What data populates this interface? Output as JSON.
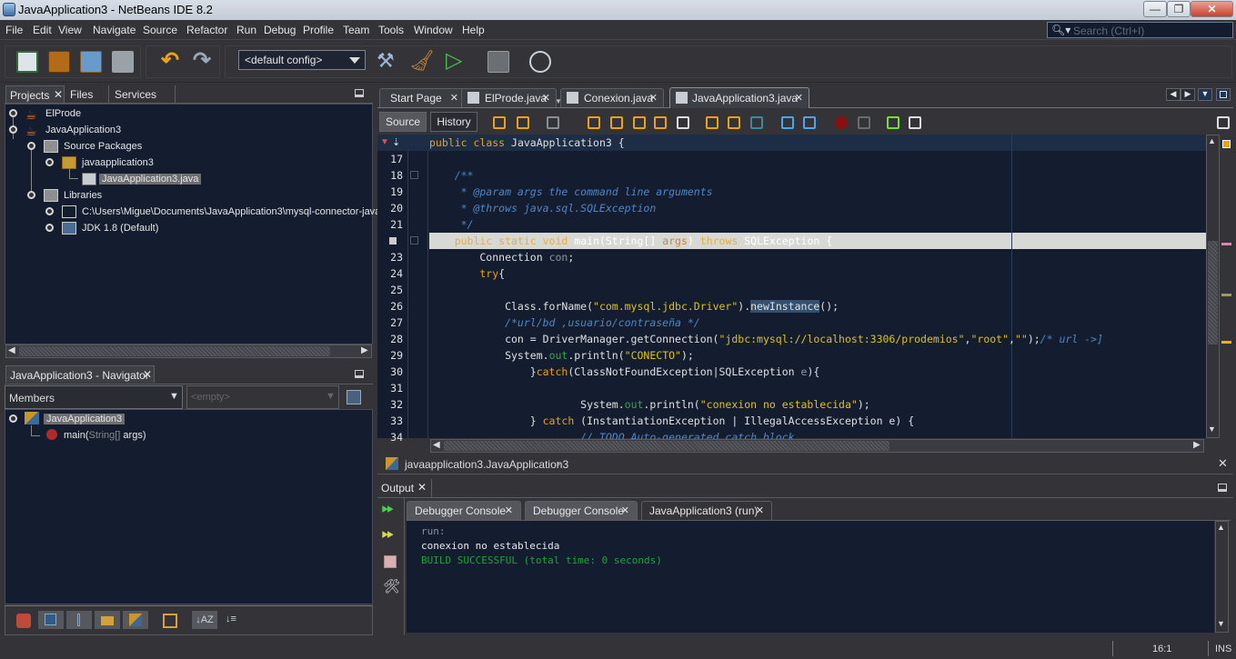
{
  "window": {
    "title": "JavaApplication3 - NetBeans IDE 8.2",
    "controls": [
      "minimize",
      "restore",
      "close"
    ]
  },
  "menu": [
    "File",
    "Edit",
    "View",
    "Navigate",
    "Source",
    "Refactor",
    "Run",
    "Debug",
    "Profile",
    "Team",
    "Tools",
    "Window",
    "Help"
  ],
  "search": {
    "placeholder": "Search (Ctrl+I)"
  },
  "toolbar": {
    "config_value": "<default config>",
    "icons": [
      "new-file-icon",
      "new-project-icon",
      "open-project-icon",
      "close-project-icon",
      "undo-icon",
      "redo-icon",
      "build-icon",
      "clean-build-icon",
      "run-icon",
      "debug-icon",
      "profile-icon"
    ]
  },
  "projects_panel": {
    "tabs": [
      {
        "label": "Projects",
        "closable": true
      },
      {
        "label": "Files"
      },
      {
        "label": "Services"
      }
    ],
    "tree": [
      {
        "label": "ElProde",
        "level": 0,
        "icon": "java-project-icon"
      },
      {
        "label": "JavaApplication3",
        "level": 0,
        "icon": "java-project-icon"
      },
      {
        "label": "Source Packages",
        "level": 1,
        "icon": "source-packages-icon"
      },
      {
        "label": "javaapplication3",
        "level": 2,
        "icon": "package-icon"
      },
      {
        "label": "JavaApplication3.java",
        "level": 3,
        "icon": "java-main-file-icon",
        "selected": true
      },
      {
        "label": "Libraries",
        "level": 1,
        "icon": "libraries-icon"
      },
      {
        "label": "C:\\Users\\Migue\\Documents\\JavaApplication3\\mysql-connector-java",
        "level": 2,
        "icon": "folder-icon"
      },
      {
        "label": "JDK 1.8 (Default)",
        "level": 2,
        "icon": "jdk-icon"
      }
    ]
  },
  "navigator": {
    "title": "JavaApplication3 - Navigator",
    "filter": "Members",
    "filter2_placeholder": "<empty>",
    "tree": [
      {
        "label": "JavaApplication3",
        "selected": true,
        "icon": "class-icon"
      },
      {
        "label_name": "main(",
        "label_type": "String[]",
        "label_rest": " args)",
        "icon": "method-icon"
      }
    ]
  },
  "editor": {
    "tabs": [
      {
        "label": "Start Page"
      },
      {
        "label": "ElProde.java"
      },
      {
        "label": "Conexion.java"
      },
      {
        "label": "JavaApplication3.java",
        "active": true
      }
    ],
    "modes": [
      "Source",
      "History"
    ],
    "lines": [
      {
        "n": "",
        "tokens": [
          [
            "kw",
            "public "
          ],
          [
            "kw",
            "class "
          ],
          [
            "",
            "JavaApplication3 {"
          ]
        ]
      },
      {
        "n": "17",
        "tokens": []
      },
      {
        "n": "18",
        "tokens": [
          [
            "cmt",
            "    /**"
          ]
        ]
      },
      {
        "n": "19",
        "tokens": [
          [
            "cmt",
            "     * @param args the command line arguments"
          ]
        ]
      },
      {
        "n": "20",
        "tokens": [
          [
            "cmt",
            "     * @throws java.sql.SQLException"
          ]
        ]
      },
      {
        "n": "21",
        "tokens": [
          [
            "cmt",
            "     */"
          ]
        ]
      },
      {
        "n": "",
        "tokens": [
          [
            "kw",
            "    public static void "
          ],
          [
            "",
            "main(String[] "
          ],
          [
            "par",
            "args"
          ],
          [
            "",
            ")"
          ],
          [
            "kw",
            " throws "
          ],
          [
            "",
            "SQLException {"
          ]
        ]
      },
      {
        "n": "23",
        "tokens": [
          [
            "",
            "        Connection "
          ],
          [
            "dim",
            "con"
          ],
          [
            "",
            ";"
          ]
        ]
      },
      {
        "n": "24",
        "tokens": [
          [
            "kw",
            "        try"
          ],
          [
            "",
            "{"
          ]
        ]
      },
      {
        "n": "25",
        "tokens": []
      },
      {
        "n": "26",
        "tokens": [
          [
            "",
            "            Class.forName("
          ],
          [
            "str",
            "\"com.mysql.jdbc.Driver\""
          ],
          [
            "",
            ")."
          ],
          [
            "sel",
            "newInstance"
          ],
          [
            "",
            "();"
          ]
        ]
      },
      {
        "n": "27",
        "tokens": [
          [
            "cmt",
            "            /*url/bd ,usuario/contraseña */"
          ]
        ]
      },
      {
        "n": "28",
        "tokens": [
          [
            "",
            "            con = DriverManager.getConnection("
          ],
          [
            "str",
            "\"jdbc:mysql://localhost:3306/prodemios\""
          ],
          [
            "",
            ","
          ],
          [
            "str",
            "\"root\""
          ],
          [
            "",
            ","
          ],
          [
            "str",
            "\"\""
          ],
          [
            "",
            ");"
          ],
          [
            "cmt",
            "/* url ->]"
          ]
        ]
      },
      {
        "n": "29",
        "tokens": [
          [
            "",
            "            System."
          ],
          [
            "fld",
            "out"
          ],
          [
            "",
            ".println("
          ],
          [
            "str",
            "\"CONECTO\""
          ],
          [
            "",
            ");"
          ]
        ]
      },
      {
        "n": "30",
        "tokens": [
          [
            "",
            "                }"
          ],
          [
            "kw",
            "catch"
          ],
          [
            "",
            "(ClassNotFoundException|SQLException "
          ],
          [
            "dim",
            "e"
          ],
          [
            "",
            "){"
          ]
        ]
      },
      {
        "n": "31",
        "tokens": []
      },
      {
        "n": "32",
        "tokens": [
          [
            "",
            "                        System."
          ],
          [
            "fld",
            "out"
          ],
          [
            "",
            ".println("
          ],
          [
            "str",
            "\"conexion no establecida\""
          ],
          [
            "",
            ");"
          ]
        ]
      },
      {
        "n": "33",
        "tokens": [
          [
            "",
            "                } "
          ],
          [
            "kw",
            "catch"
          ],
          [
            "",
            " (InstantiationException | IllegalAccessException e) {"
          ]
        ]
      },
      {
        "n": "34",
        "tokens": [
          [
            "cmt",
            "                        // TODO Auto-generated catch block"
          ]
        ]
      }
    ]
  },
  "breadcrumb": "javaapplication3.JavaApplication3",
  "output": {
    "title": "Output",
    "tabs": [
      {
        "label": "Debugger Console"
      },
      {
        "label": "Debugger Console"
      },
      {
        "label": "JavaApplication3 (run)",
        "active": true
      }
    ],
    "lines": [
      {
        "text": "run:",
        "color": "#8a8f96"
      },
      {
        "text": "conexion no establecida",
        "color": "#e6e6e6"
      },
      {
        "text": "BUILD SUCCESSFUL (total time: 0 seconds)",
        "color": "#1fa33a"
      }
    ]
  },
  "status": {
    "position": "16:1",
    "mode": "INS"
  }
}
